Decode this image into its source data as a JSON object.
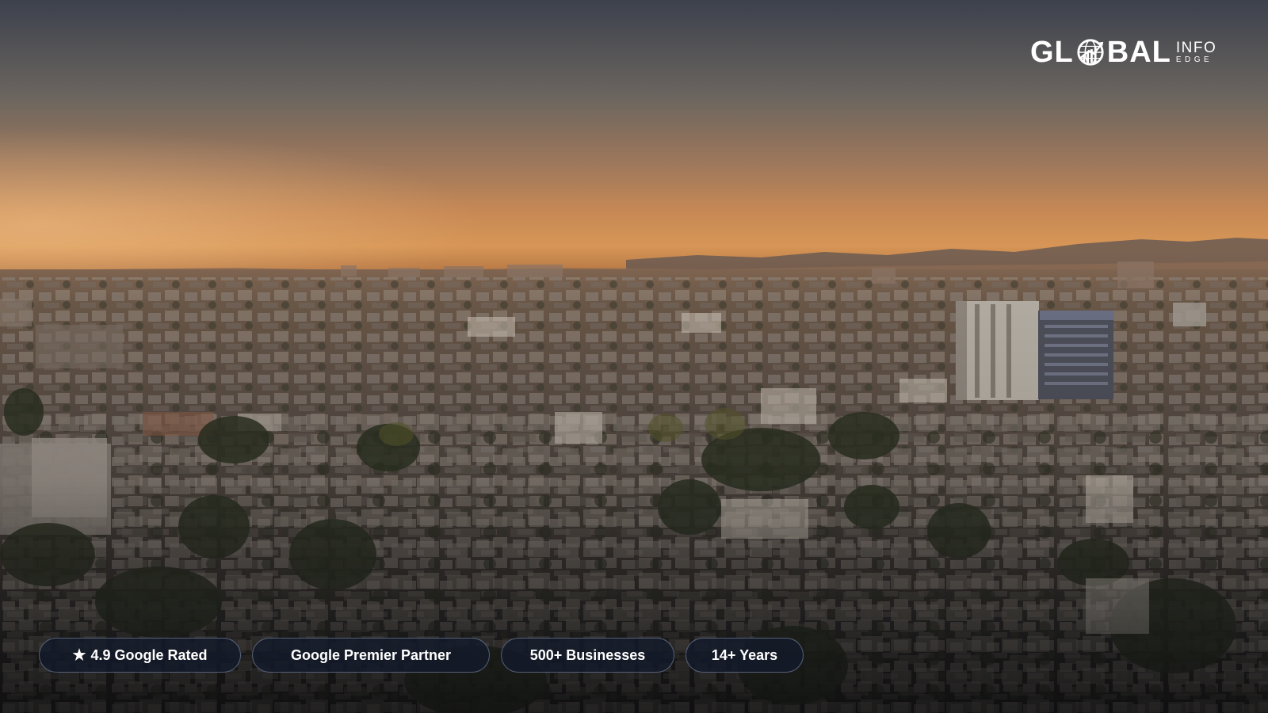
{
  "logo": {
    "text_main_left": "GL",
    "text_main_right": "BAL",
    "text_sub_top": "INFO",
    "text_sub_bottom": "EDGE",
    "icon": "globe-chart-icon"
  },
  "badges": [
    {
      "icon": "star-icon",
      "label": "4.9 Google Rated"
    },
    {
      "label": "Google Premier Partner"
    },
    {
      "label": "500+ Businesses"
    },
    {
      "label": "14+ Years"
    }
  ],
  "background": {
    "description_icon": "city-skyline-image",
    "sky_top": "#3f4450",
    "sky_horizon": "#c98a55",
    "ground_dark": "#1d1c1f"
  },
  "colors": {
    "badge_bg": "#121a2a",
    "badge_border": "#8c9bb9",
    "text": "#ffffff"
  }
}
